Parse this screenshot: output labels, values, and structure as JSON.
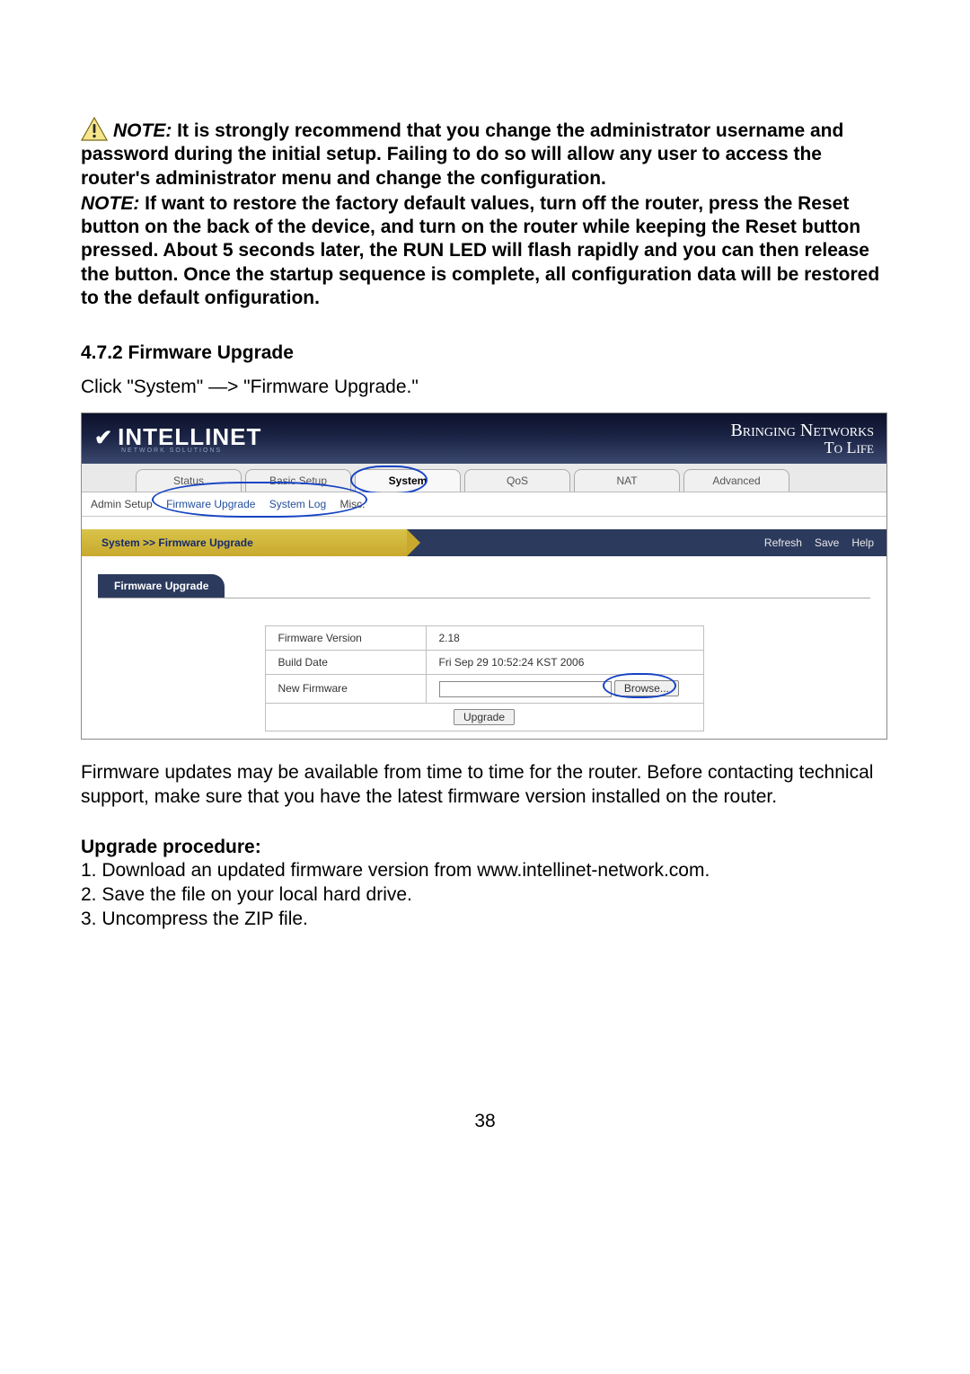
{
  "notes": {
    "note1_prefix": "NOTE:",
    "note1_body": " It is strongly recommend that you change the administrator username and password during the initial setup. Failing to do so will allow any user to access the router's administrator menu and change the configuration.",
    "note2_prefix": "NOTE:",
    "note2_body": " If want to restore the factory default values, turn off the router, press the Reset button on the back of the device, and turn on the router while keeping the Reset button pressed. About 5 seconds later, the RUN LED will flash rapidly and you can then release the button. Once the startup sequence is complete, all configuration data will be restored to the default onfiguration."
  },
  "section": {
    "heading": "4.7.2 Firmware Upgrade",
    "instruction": "Click \"System\" —> \"Firmware Upgrade.\""
  },
  "screenshot": {
    "brand": "INTELLINET",
    "brand_sub": "NETWORK SOLUTIONS",
    "tagline1": "Bringing Networks",
    "tagline2": "To Life",
    "tabs": [
      "Status",
      "Basic Setup",
      "System",
      "QoS",
      "NAT",
      "Advanced"
    ],
    "active_tab_index": 2,
    "subnav": [
      "Admin Setup",
      "Firmware Upgrade",
      "System Log",
      "Misc."
    ],
    "breadcrumb": "System >> Firmware Upgrade",
    "actions": [
      "Refresh",
      "Save",
      "Help"
    ],
    "panel_title": "Firmware Upgrade",
    "rows": {
      "fw_version_label": "Firmware Version",
      "fw_version_value": "2.18",
      "build_date_label": "Build Date",
      "build_date_value": "Fri Sep 29 10:52:24 KST 2006",
      "new_fw_label": "New Firmware",
      "browse_btn": "Browse...",
      "upgrade_btn": "Upgrade"
    }
  },
  "body_text": "Firmware updates may be available from time to time for the router. Before contacting technical support, make sure that you have the latest firmware version installed on the router.",
  "procedure": {
    "heading": "Upgrade procedure:",
    "steps": [
      "1. Download an updated firmware version from www.intellinet-network.com.",
      "2. Save the file on your local hard drive.",
      "3. Uncompress the ZIP file."
    ]
  },
  "page_number": "38"
}
